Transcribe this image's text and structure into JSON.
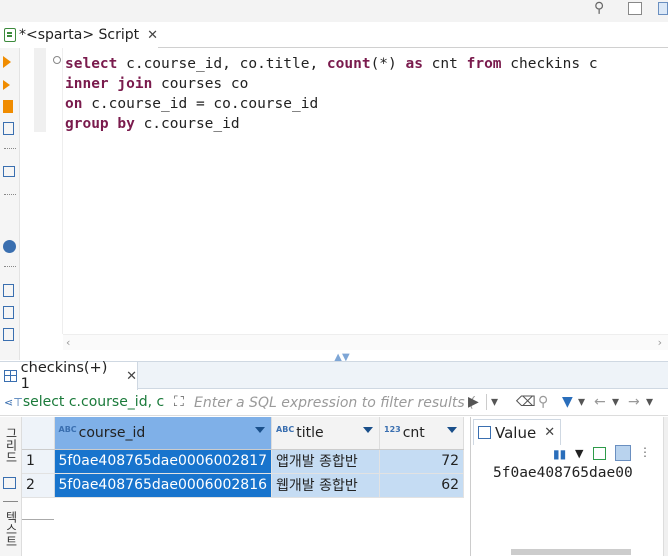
{
  "editor_tab": {
    "title": "*<sparta> Script"
  },
  "editor": {
    "lines": [
      [
        {
          "t": "select",
          "k": true
        },
        {
          "t": " c.course_id, co.title, ",
          "k": false
        },
        {
          "t": "count",
          "k": true
        },
        {
          "t": "(*) ",
          "k": false
        },
        {
          "t": "as",
          "k": true
        },
        {
          "t": " cnt ",
          "k": false
        },
        {
          "t": "from",
          "k": true
        },
        {
          "t": " checkins c",
          "k": false
        }
      ],
      [
        {
          "t": "inner join",
          "k": true
        },
        {
          "t": " courses co",
          "k": false
        }
      ],
      [
        {
          "t": "on",
          "k": true
        },
        {
          "t": " c.course_id = co.course_id",
          "k": false
        }
      ],
      [
        {
          "t": "group by",
          "k": true
        },
        {
          "t": " c.course_id",
          "k": false
        }
      ]
    ]
  },
  "results": {
    "tab_label": "checkins(+) 1",
    "query_preview": "select c.course_id, co.",
    "filter_placeholder": "Enter a SQL expression to filter results (",
    "left_vertical_tabs": [
      "그리드",
      "텍스트"
    ],
    "columns": [
      {
        "type": "ABC",
        "name": "course_id"
      },
      {
        "type": "ABC",
        "name": "title"
      },
      {
        "type": "123",
        "name": "cnt"
      }
    ],
    "rows": [
      {
        "num": "1",
        "course_id": "5f0ae408765dae0006002817",
        "title": "앱개발 종합반",
        "cnt": "72"
      },
      {
        "num": "2",
        "course_id": "5f0ae408765dae0006002816",
        "title": "웹개발 종합반",
        "cnt": "62"
      }
    ]
  },
  "value_panel": {
    "tab_label": "Value",
    "value": "5f0ae408765dae00"
  },
  "colors": {
    "keyword": "#7a1b4d",
    "selection": "#1874cd",
    "row_highlight": "#c5dcf3",
    "query_text": "#1a7a3a"
  }
}
